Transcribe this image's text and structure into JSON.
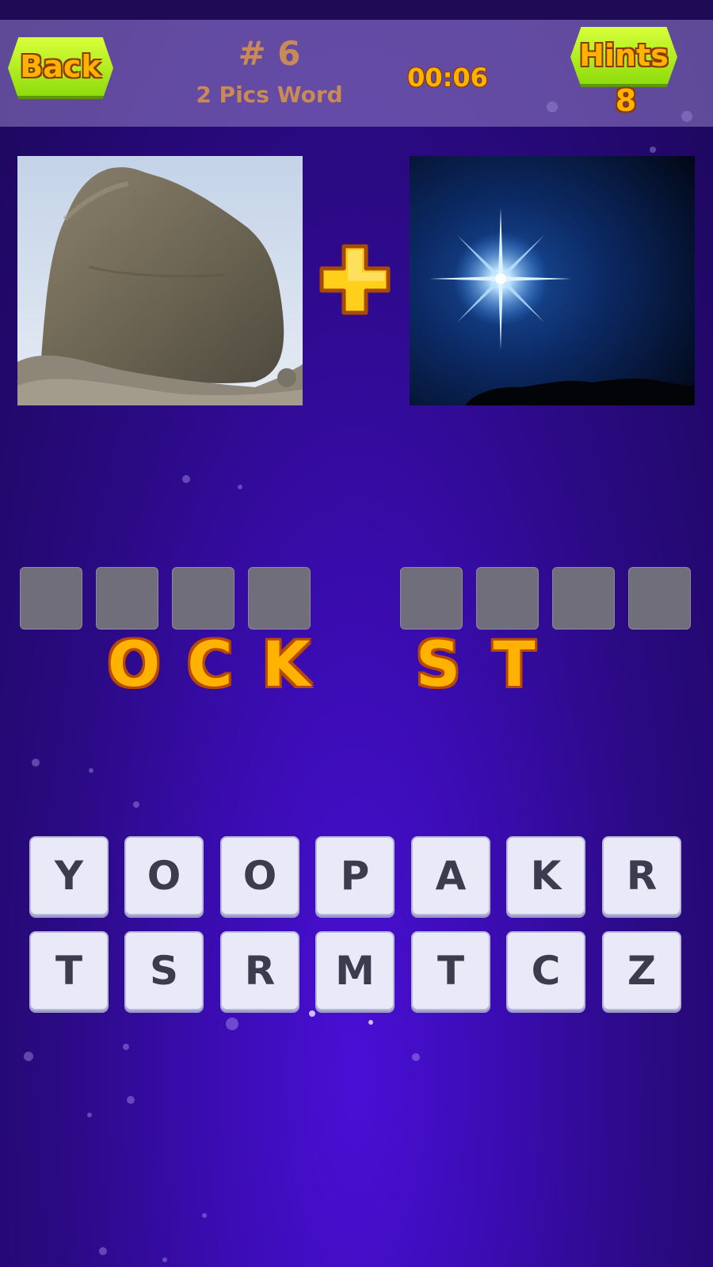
{
  "header": {
    "back_label": "Back",
    "level_number": "# 6",
    "game_title": "2 Pics Word",
    "timer": "00:06",
    "hints_label": "Hints",
    "hints_count": "8"
  },
  "pictures": {
    "left": "rock-photo",
    "operator": "plus-icon",
    "right": "star-photo"
  },
  "answer": {
    "word1_slots": 4,
    "word2_slots": 4,
    "revealed_letters": [
      "O",
      "C",
      "K",
      "S",
      "T"
    ]
  },
  "keyboard": {
    "row1": [
      "Y",
      "O",
      "O",
      "P",
      "A",
      "K",
      "R"
    ],
    "row2": [
      "T",
      "S",
      "R",
      "M",
      "T",
      "C",
      "Z"
    ]
  },
  "colors": {
    "accent_orange": "#ffb300",
    "button_green": "#a7e81a",
    "slot_gray": "#6f6e7a",
    "key_bg": "#e9e9f8",
    "background_purple": "#3a0cb0"
  }
}
